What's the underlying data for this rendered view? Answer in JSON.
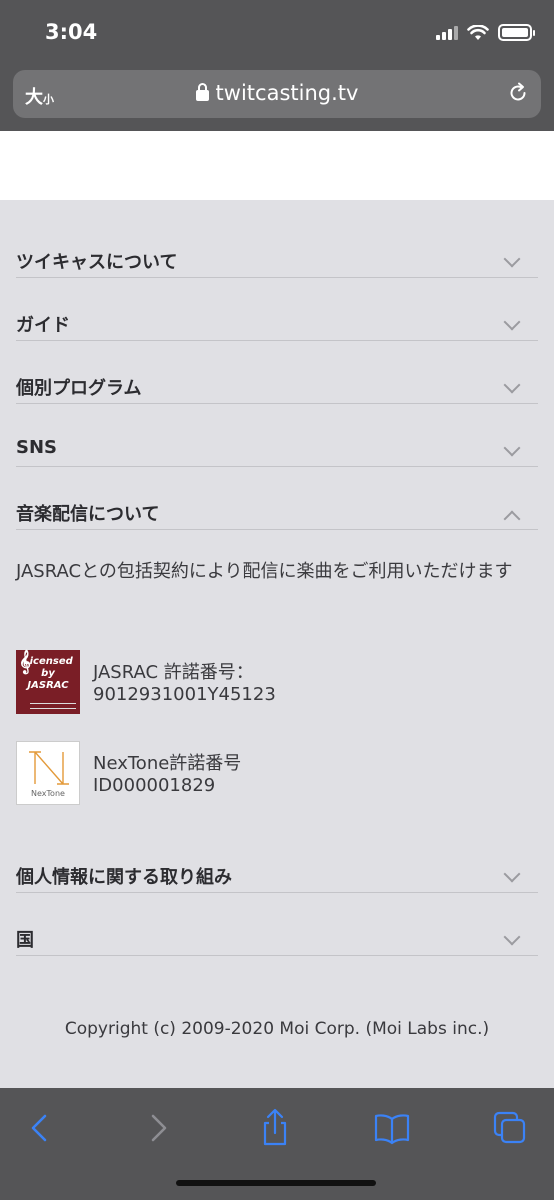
{
  "status_bar": {
    "time": "3:04"
  },
  "browser": {
    "text_size_big": "大",
    "text_size_small": "小",
    "url": "twitcasting.tv"
  },
  "sections": [
    {
      "label": "ツイキャスについて",
      "expanded": false
    },
    {
      "label": "ガイド",
      "expanded": false
    },
    {
      "label": "個別プログラム",
      "expanded": false
    },
    {
      "label": "SNS",
      "expanded": false
    },
    {
      "label": "音楽配信について",
      "expanded": true
    },
    {
      "label": "個人情報に関する取り組み",
      "expanded": false
    },
    {
      "label": "国",
      "expanded": false
    }
  ],
  "music": {
    "description": "JASRACとの包括契約により配信に楽曲をご利用いただけます",
    "jasrac": {
      "logo_lines": [
        "Licensed",
        "by",
        "JASRAC"
      ],
      "line1": "JASRAC 許諾番号：",
      "line2": "9012931001Y45123"
    },
    "nextone": {
      "logo_word": "NexTone",
      "line1": "NexTone許諾番号",
      "line2": "ID000001829"
    }
  },
  "footer": {
    "copyright": "Copyright (c) 2009-2020 Moi Corp. (Moi Labs inc.)"
  },
  "colors": {
    "chrome": "#555557",
    "toolbar_icon": "#3b82f6",
    "toolbar_icon_disabled": "#8e8e93",
    "background": "#e0e0e4"
  }
}
